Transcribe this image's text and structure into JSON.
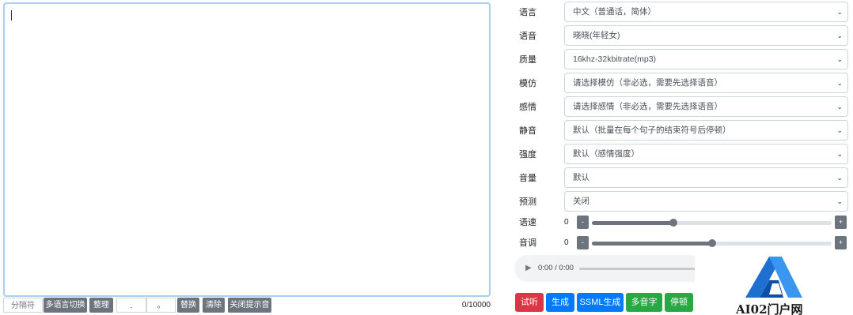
{
  "editor": {
    "char_count": "0/10000"
  },
  "toolbar": {
    "separator_placeholder": "分隔符",
    "multilang_switch": "多语言切换",
    "tidy": "整理",
    "find_value": ".",
    "replace_value": "。",
    "replace": "替换",
    "clear": "清除",
    "close_tip_sound": "关闭提示音"
  },
  "settings": [
    {
      "label": "语言",
      "value": "中文（普通话，简体）"
    },
    {
      "label": "语音",
      "value": "晓晓(年轻女)"
    },
    {
      "label": "质量",
      "value": "16khz-32kbitrate(mp3)"
    },
    {
      "label": "模仿",
      "value": "请选择模仿（非必选，需要先选择语音）"
    },
    {
      "label": "感情",
      "value": "请选择感情（非必选，需要先选择语音）"
    },
    {
      "label": "静音",
      "value": "默认（批量在每个句子的结束符号后停顿）"
    },
    {
      "label": "强度",
      "value": "默认（感情强度）"
    },
    {
      "label": "音量",
      "value": "默认"
    },
    {
      "label": "预测",
      "value": "关闭"
    }
  ],
  "sliders": {
    "speed": {
      "label": "语速",
      "value": "0",
      "level": 0.34,
      "minus": "-",
      "plus": "+"
    },
    "pitch": {
      "label": "音调",
      "value": "0",
      "level": 0.5,
      "minus": "-",
      "plus": "+"
    }
  },
  "audio": {
    "time": "0:00 / 0:00",
    "play_icon": "play-icon"
  },
  "actions": {
    "listen": "试听",
    "generate": "生成",
    "ssml_generate": "SSML生成",
    "polyphone": "多音字",
    "pause": "停顿"
  },
  "colors": {
    "listen": "#dc3545",
    "generate": "#007bff",
    "ssml": "#007bff",
    "polyphone": "#28a745",
    "pause": "#28a745",
    "secondary": "#6c757d"
  },
  "watermark": {
    "text": "AI02门户网"
  }
}
